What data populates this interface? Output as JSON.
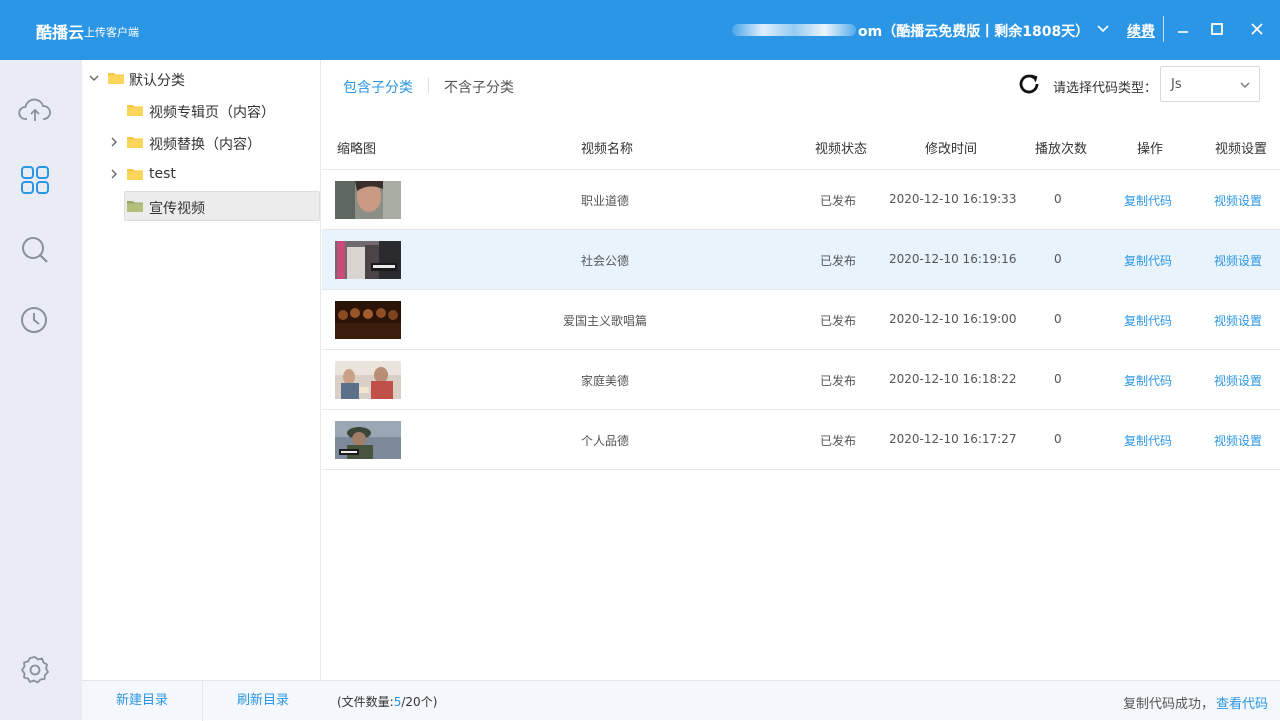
{
  "app": {
    "name": "酷播云",
    "subtitle": "上传客户端"
  },
  "account": {
    "suffix": "om",
    "plan": "（酷播云免费版丨剩余1808天）",
    "renew_label": "续费"
  },
  "sidebar_icons": [
    "cloud-upload-icon",
    "apps-icon",
    "search-icon",
    "clock-icon",
    "gear-icon"
  ],
  "tree": [
    {
      "label": "默认分类",
      "expanded": true
    },
    {
      "label": "视频专辑页（内容）"
    },
    {
      "label": "视频替换（内容）",
      "collapsed": true
    },
    {
      "label": "test",
      "collapsed": true
    },
    {
      "label": "宣传视频",
      "selected": true
    }
  ],
  "tree_footer": {
    "new_dir": "新建目录",
    "refresh_dir": "刷新目录"
  },
  "filters": {
    "include_sub": "包含子分类",
    "exclude_sub": "不含子分类"
  },
  "code_type": {
    "label": "请选择代码类型：",
    "selected": "Js"
  },
  "columns": {
    "thumb": "缩略图",
    "name": "视频名称",
    "status": "视频状态",
    "modified": "修改时间",
    "plays": "播放次数",
    "action": "操作",
    "settings": "视频设置"
  },
  "rows": [
    {
      "name": "职业道德",
      "status": "已发布",
      "modified": "2020-12-10 16:19:33",
      "plays": "0",
      "action": "复制代码",
      "settings": "视频设置"
    },
    {
      "name": "社会公德",
      "status": "已发布",
      "modified": "2020-12-10 16:19:16",
      "plays": "0",
      "action": "复制代码",
      "settings": "视频设置"
    },
    {
      "name": "爱国主义歌唱篇",
      "status": "已发布",
      "modified": "2020-12-10 16:19:00",
      "plays": "0",
      "action": "复制代码",
      "settings": "视频设置"
    },
    {
      "name": "家庭美德",
      "status": "已发布",
      "modified": "2020-12-10 16:18:22",
      "plays": "0",
      "action": "复制代码",
      "settings": "视频设置"
    },
    {
      "name": "个人品德",
      "status": "已发布",
      "modified": "2020-12-10 16:17:27",
      "plays": "0",
      "action": "复制代码",
      "settings": "视频设置"
    }
  ],
  "status_bar": {
    "count_prefix": "(文件数量:",
    "count": "5",
    "count_suffix": "/20个)",
    "message": "复制代码成功，",
    "view_code": "查看代码"
  },
  "colors": {
    "accent": "#2b96e6",
    "row_highlight": "#e8f3fc",
    "rail_bg": "#e9edf3"
  }
}
